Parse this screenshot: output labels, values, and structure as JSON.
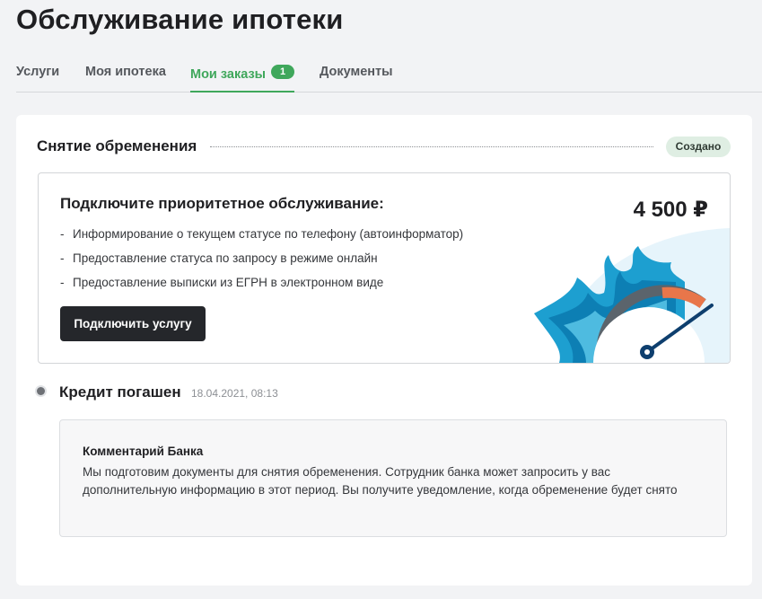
{
  "page": {
    "title": "Обслуживание ипотеки"
  },
  "tabs": [
    {
      "label": "Услуги",
      "active": false
    },
    {
      "label": "Моя ипотека",
      "active": false
    },
    {
      "label": "Мои заказы",
      "active": true,
      "badge": "1"
    },
    {
      "label": "Документы",
      "active": false
    }
  ],
  "order": {
    "title": "Снятие обременения",
    "status": "Создано",
    "promo": {
      "title": "Подключите приоритетное обслуживание:",
      "price": "4 500 ₽",
      "features": [
        "Информирование о текущем статусе по телефону (автоинформатор)",
        "Предоставление статуса по запросу в режиме онлайн",
        "Предоставление выписки из ЕГРН в электронном виде"
      ],
      "button_label": "Подключить услугу",
      "illustration_icon": "speedometer-icon"
    },
    "event": {
      "title": "Кредит погашен",
      "date": "18.04.2021, 08:13"
    },
    "comment": {
      "title": "Комментарий Банка",
      "text": "Мы подготовим документы для снятия обременения. Сотрудник банка может запросить у вас дополнительную информацию в этот период. Вы получите уведомление, когда обременение будет снято"
    }
  },
  "colors": {
    "accent": "#3fa75b",
    "button_dark": "#25272b",
    "status_bg": "#dfeee3",
    "flame_blue": "#1d9fd0",
    "gauge_orange": "#e8764a",
    "needle": "#0e3f6e"
  }
}
